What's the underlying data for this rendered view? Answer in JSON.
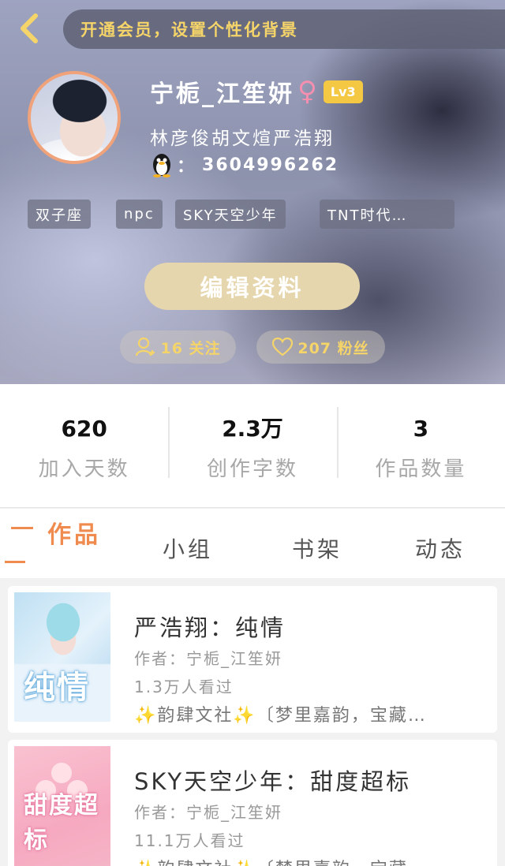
{
  "header": {
    "vip_banner": "开通会员，设置个性化背景",
    "username": "宁栀_江笙妍",
    "gender_symbol": "♀",
    "level": "Lv3",
    "bio": "林彦俊胡文煊严浩翔",
    "qq_colon": "：",
    "qq_number": "3604996262",
    "tags": [
      "双子座",
      "npc",
      "SKY天空少年",
      "TNT时代…"
    ],
    "edit_label": "编辑资料",
    "following": "16 关注",
    "followers": "207 粉丝"
  },
  "stats": [
    {
      "value": "620",
      "label": "加入天数"
    },
    {
      "value": "2.3万",
      "label": "创作字数"
    },
    {
      "value": "3",
      "label": "作品数量"
    }
  ],
  "tabs": [
    {
      "label": "作品",
      "active": true
    },
    {
      "label": "小组",
      "active": false
    },
    {
      "label": "书架",
      "active": false
    },
    {
      "label": "动态",
      "active": false
    }
  ],
  "books": [
    {
      "title": "严浩翔：纯情",
      "cover_text": "纯情",
      "author": "作者：宁栀_江笙妍",
      "views": "1.3万人看过",
      "desc_prefix": "✨",
      "desc_org": "韵肆文社",
      "desc_suffix": "✨〔梦里嘉韵，宝藏…"
    },
    {
      "title": "SKY天空少年：甜度超标",
      "cover_text": "甜度超标",
      "author": "作者：宁栀_江笙妍",
      "views": "11.1万人看过",
      "desc_prefix": "✨",
      "desc_org": "韵肆文社",
      "desc_suffix": "✨〔梦里嘉韵，宝藏…"
    }
  ],
  "colors": {
    "accent": "#f08b4f",
    "gold": "#f5d469",
    "level_badge": "#f5c844",
    "edit_button": "#e6d6ad"
  }
}
